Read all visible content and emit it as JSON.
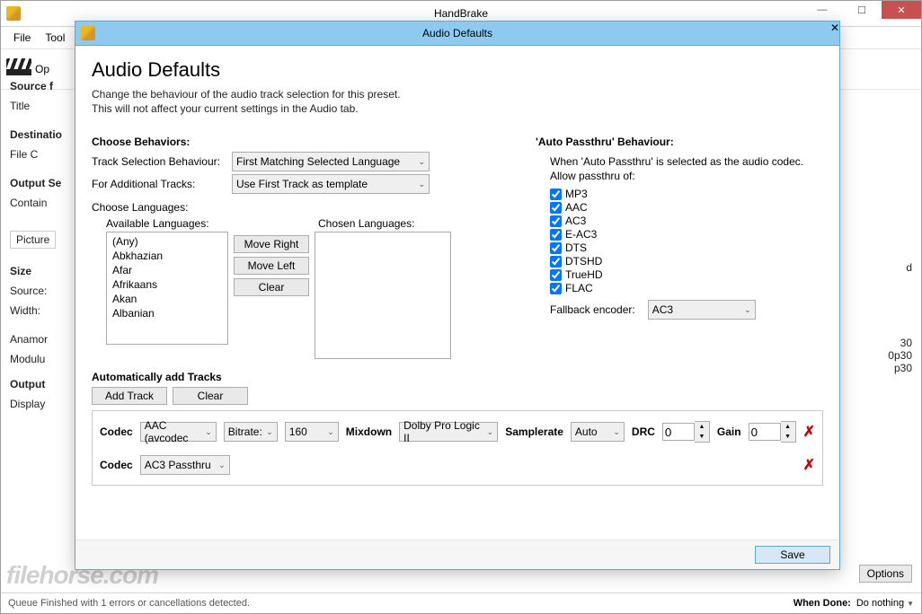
{
  "main_window": {
    "title": "HandBrake",
    "menu": {
      "file": "File",
      "tools": "Tool"
    },
    "toolbar": {
      "open": "Op"
    },
    "bg_labels": {
      "source": "Source   f",
      "title": "Title",
      "destination": "Destinatio",
      "file": "File    C",
      "output_settings": "Output Se",
      "container": "Contain",
      "picture_tab": "Picture",
      "size": "Size",
      "source2": "Source:",
      "width": "Width:",
      "anamorphic": "Anamor",
      "modulus": "Modulu",
      "output": "Output",
      "display": "Display"
    },
    "right_labels": {
      "d": "d",
      "r30": "30",
      "r0p30": "0p30",
      "rp30": "p30",
      "options": "Options"
    },
    "status": "Queue Finished with 1 errors or cancellations detected.",
    "when_done_label": "When Done:",
    "when_done_value": "Do nothing",
    "watermark": "filehorse.com"
  },
  "dialog": {
    "title": "Audio Defaults",
    "heading": "Audio Defaults",
    "sub1": "Change the behaviour of the audio track selection for this preset.",
    "sub2": "This will not affect your current settings in the Audio tab.",
    "choose_behaviors": "Choose Behaviors:",
    "track_sel_label": "Track Selection Behaviour:",
    "track_sel_value": "First Matching Selected Language",
    "additional_label": "For Additional Tracks:",
    "additional_value": "Use First Track as template",
    "choose_languages": "Choose Languages:",
    "available_label": "Available Languages:",
    "available": [
      "(Any)",
      "Abkhazian",
      "Afar",
      "Afrikaans",
      "Akan",
      "Albanian"
    ],
    "chosen_label": "Chosen Languages:",
    "move_right": "Move Right",
    "move_left": "Move Left",
    "clear": "Clear",
    "auto_passthru_title": "'Auto Passthru' Behaviour:",
    "auto_passthru_desc1": "When 'Auto Passthru' is selected as the audio codec.",
    "auto_passthru_desc2": "Allow passthru of:",
    "passthru": [
      "MP3",
      "AAC",
      "AC3",
      "E-AC3",
      "DTS",
      "DTSHD",
      "TrueHD",
      "FLAC"
    ],
    "fallback_label": "Fallback encoder:",
    "fallback_value": "AC3",
    "auto_add": "Automatically add Tracks",
    "add_track": "Add Track",
    "clear2": "Clear",
    "track1": {
      "codec_label": "Codec",
      "codec": "AAC (avcodec",
      "bitrate_label": "Bitrate:",
      "bitrate": "160",
      "mixdown_label": "Mixdown",
      "mixdown": "Dolby Pro Logic II",
      "samplerate_label": "Samplerate",
      "samplerate": "Auto",
      "drc_label": "DRC",
      "drc": "0",
      "gain_label": "Gain",
      "gain": "0"
    },
    "track2": {
      "codec_label": "Codec",
      "codec": "AC3 Passthru"
    },
    "save": "Save"
  }
}
